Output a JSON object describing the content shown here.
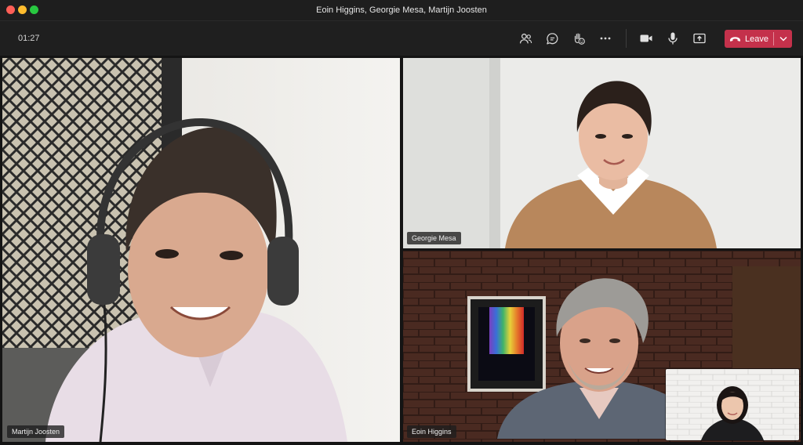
{
  "window": {
    "title": "Eoin Higgins, Georgie Mesa, Martijn Joosten"
  },
  "toolbar": {
    "timer": "01:27",
    "leave_label": "Leave",
    "icons": [
      "people-icon",
      "chat-icon",
      "reactions-icon",
      "more-icon",
      "camera-icon",
      "mic-icon",
      "share-icon"
    ]
  },
  "participants": [
    {
      "name": "Martijn Joosten"
    },
    {
      "name": "Georgie Mesa"
    },
    {
      "name": "Eoin Higgins"
    }
  ],
  "colors": {
    "leave": "#c4314b",
    "active_speaker_border": "#9ea2ff"
  }
}
